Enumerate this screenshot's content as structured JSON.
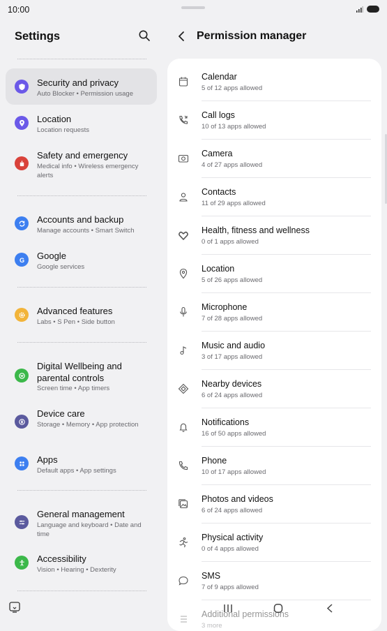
{
  "status": {
    "time": "10:00"
  },
  "settings": {
    "title": "Settings",
    "items": [
      {
        "title": "Security and privacy",
        "subtitle": "Auto Blocker • Permission usage",
        "color": "#6b59e8",
        "icon": "shield-icon"
      },
      {
        "title": "Location",
        "subtitle": "Location requests",
        "color": "#6b59e8",
        "icon": "location-pin-icon"
      },
      {
        "title": "Safety and emergency",
        "subtitle": "Medical info • Wireless emergency alerts",
        "color": "#d9423a",
        "icon": "emergency-icon"
      },
      {
        "title": "Accounts and backup",
        "subtitle": "Manage accounts • Smart Switch",
        "color": "#3d7ff0",
        "icon": "sync-icon"
      },
      {
        "title": "Google",
        "subtitle": "Google services",
        "color": "#3d7ff0",
        "icon": "google-icon"
      },
      {
        "title": "Advanced features",
        "subtitle": "Labs • S Pen • Side button",
        "color": "#f2b43a",
        "icon": "gear-plus-icon"
      },
      {
        "title": "Digital Wellbeing and parental controls",
        "subtitle": "Screen time • App timers",
        "color": "#3cb84a",
        "icon": "heart-icon"
      },
      {
        "title": "Device care",
        "subtitle": "Storage • Memory • App protection",
        "color": "#5b5a9e",
        "icon": "device-care-icon"
      },
      {
        "title": "Apps",
        "subtitle": "Default apps • App settings",
        "color": "#3d7ff0",
        "icon": "apps-grid-icon"
      },
      {
        "title": "General management",
        "subtitle": "Language and keyboard • Date and time",
        "color": "#5b5a9e",
        "icon": "sliders-icon"
      },
      {
        "title": "Accessibility",
        "subtitle": "Vision • Hearing • Dexterity",
        "color": "#3cb84a",
        "icon": "accessibility-icon"
      }
    ]
  },
  "permission_manager": {
    "title": "Permission manager",
    "items": [
      {
        "title": "Calendar",
        "subtitle": "5 of 12 apps allowed",
        "icon": "calendar-icon"
      },
      {
        "title": "Call logs",
        "subtitle": "10 of 13 apps allowed",
        "icon": "call-log-icon"
      },
      {
        "title": "Camera",
        "subtitle": "4 of 27 apps allowed",
        "icon": "camera-icon"
      },
      {
        "title": "Contacts",
        "subtitle": "11 of 29 apps allowed",
        "icon": "contacts-icon"
      },
      {
        "title": "Health, fitness and wellness",
        "subtitle": "0 of 1 apps allowed",
        "icon": "health-icon"
      },
      {
        "title": "Location",
        "subtitle": "5 of 26 apps allowed",
        "icon": "location-icon"
      },
      {
        "title": "Microphone",
        "subtitle": "7 of 28 apps allowed",
        "icon": "microphone-icon"
      },
      {
        "title": "Music and audio",
        "subtitle": "3 of 17 apps allowed",
        "icon": "music-icon"
      },
      {
        "title": "Nearby devices",
        "subtitle": "6 of 24 apps allowed",
        "icon": "nearby-devices-icon"
      },
      {
        "title": "Notifications",
        "subtitle": "16 of 50 apps allowed",
        "icon": "bell-icon"
      },
      {
        "title": "Phone",
        "subtitle": "10 of 17 apps allowed",
        "icon": "phone-icon"
      },
      {
        "title": "Photos and videos",
        "subtitle": "6 of 24 apps allowed",
        "icon": "photos-icon"
      },
      {
        "title": "Physical activity",
        "subtitle": "0 of 4 apps allowed",
        "icon": "activity-icon"
      },
      {
        "title": "SMS",
        "subtitle": "7 of 9 apps allowed",
        "icon": "sms-icon"
      },
      {
        "title": "Additional permissions",
        "subtitle": "3 more",
        "icon": "list-icon"
      }
    ]
  }
}
